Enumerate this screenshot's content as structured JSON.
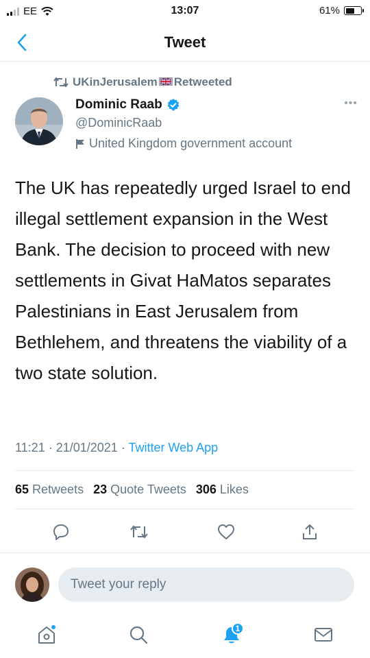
{
  "status_bar": {
    "carrier": "EE",
    "time": "13:07",
    "battery_percent": "61%",
    "battery_level": 0.61
  },
  "nav": {
    "title": "Tweet"
  },
  "retweet": {
    "account": "UKinJerusalem",
    "label": "Retweeted"
  },
  "author": {
    "display_name": "Dominic Raab",
    "handle": "@DominicRaab",
    "gov_label": "United Kingdom government account",
    "verified": true
  },
  "tweet": {
    "text": "The UK has repeatedly urged Israel to end illegal settlement expansion in the West Bank. The decision to proceed with new settlements in Givat HaMatos separates Palestinians in East Jerusalem from Bethlehem, and threatens the viability of a two state solution.",
    "timestamp": "11:21 · 21/01/2021 · ",
    "source_app": "Twitter Web App"
  },
  "stats": {
    "retweets": "65",
    "retweets_label": "Retweets",
    "quotes": "23",
    "quotes_label": "Quote Tweets",
    "likes": "306",
    "likes_label": "Likes"
  },
  "reply": {
    "placeholder": "Tweet your reply"
  },
  "tabs": {
    "notification_count": "1"
  },
  "colors": {
    "accent": "#1da1f2",
    "secondary_text": "#657786",
    "primary_text": "#14171a",
    "divider": "#e6ecf0"
  },
  "icons": [
    "signal-icon",
    "wifi-icon",
    "battery-icon",
    "back-chevron-icon",
    "retweet-icon",
    "uk-flag-icon",
    "verified-badge-icon",
    "government-flag-icon",
    "more-dots-icon",
    "reply-icon",
    "retweet-action-icon",
    "like-heart-icon",
    "share-icon",
    "home-icon",
    "search-icon",
    "notifications-bell-icon",
    "messages-envelope-icon"
  ]
}
